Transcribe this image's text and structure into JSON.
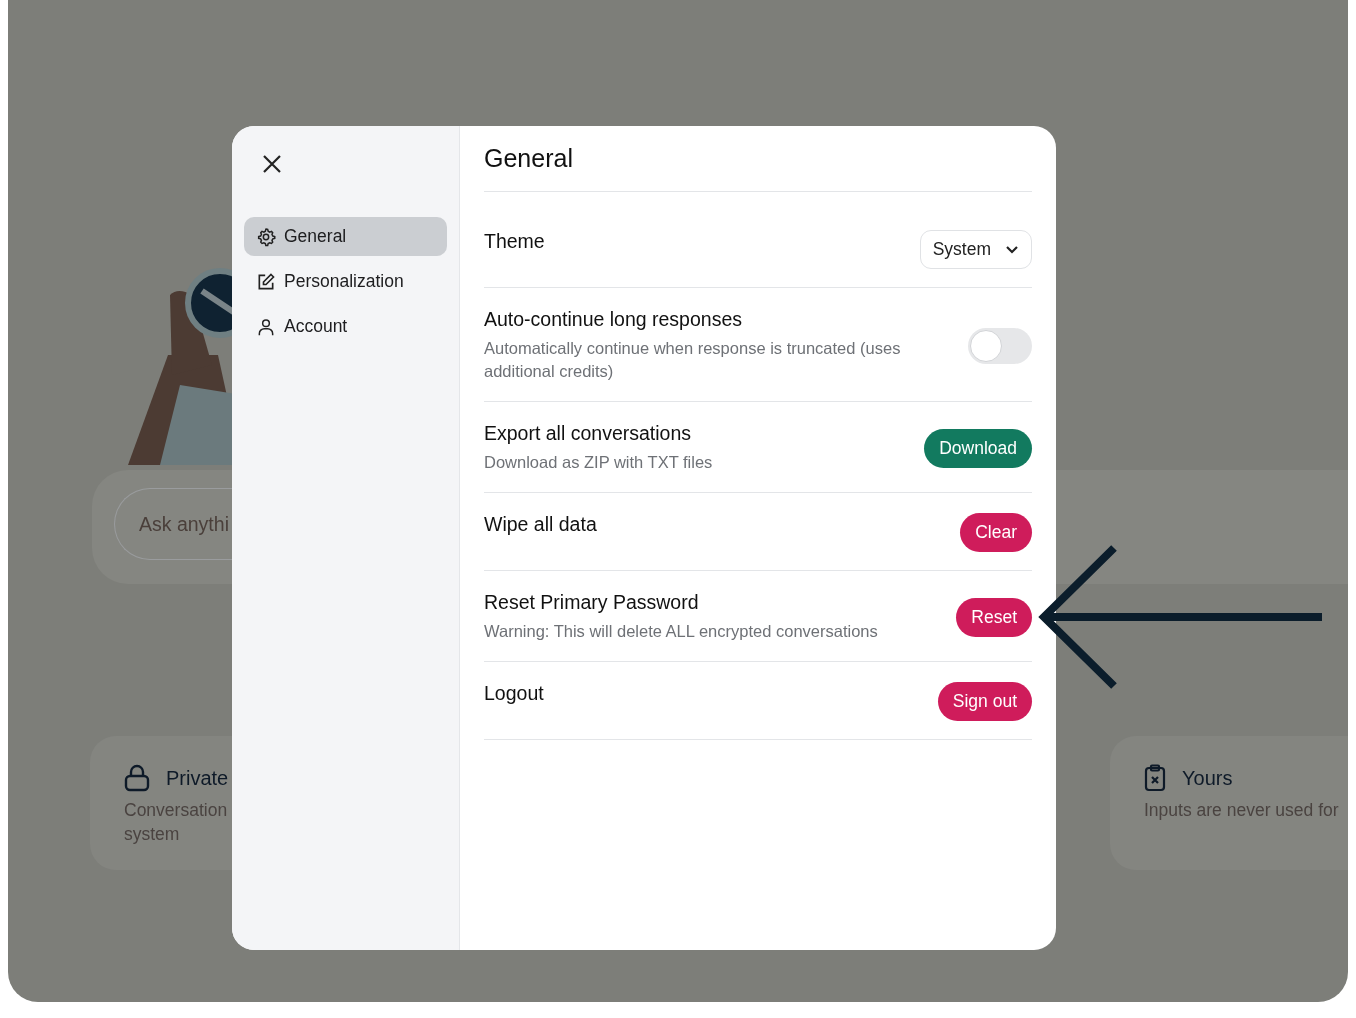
{
  "background": {
    "search": {
      "placeholder": "Ask anythi"
    },
    "cards": [
      {
        "title": "Private",
        "lines": [
          "Conversation",
          "system"
        ]
      },
      {
        "title": "Yours",
        "lines": [
          "Inputs are never used for"
        ]
      }
    ]
  },
  "settings": {
    "nav": [
      {
        "label": "General",
        "selected": true
      },
      {
        "label": "Personalization",
        "selected": false
      },
      {
        "label": "Account",
        "selected": false
      }
    ],
    "title": "General",
    "rows": [
      {
        "kind": "select",
        "label": "Theme",
        "value": "System"
      },
      {
        "kind": "toggle",
        "label": "Auto-continue long responses",
        "description": "Automatically continue when response is truncated (uses additional credits)",
        "on": false
      },
      {
        "kind": "button",
        "label": "Export all conversations",
        "description": "Download as ZIP with TXT files",
        "button": "Download",
        "color": "#127a5f"
      },
      {
        "kind": "button",
        "label": "Wipe all data",
        "button": "Clear",
        "color": "#cf1c5b"
      },
      {
        "kind": "button",
        "label": "Reset Primary Password",
        "description": "Warning: This will delete ALL encrypted conversations",
        "button": "Reset",
        "color": "#cf1c5b"
      },
      {
        "kind": "button",
        "label": "Logout",
        "button": "Sign out",
        "color": "#cf1c5b"
      }
    ]
  }
}
